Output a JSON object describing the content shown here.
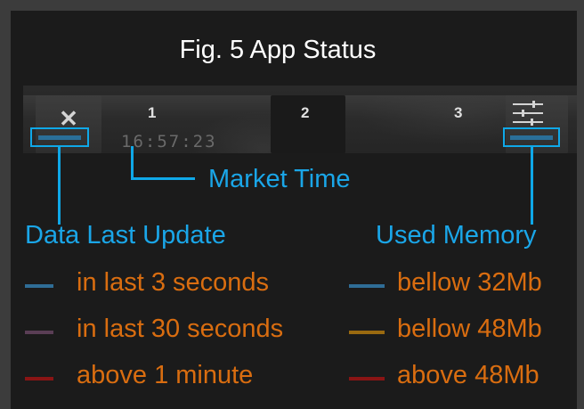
{
  "title": "Fig. 5 App Status",
  "toolbar": {
    "close_icon": "close-icon",
    "tab_1": "1",
    "tab_2": "2",
    "tab_3": "3",
    "clock": "16:57:23",
    "settings_icon": "sliders-icon"
  },
  "callouts": {
    "market_time": "Market Time",
    "data_last_update": "Data Last Update",
    "used_memory": "Used Memory"
  },
  "legend_left": [
    {
      "label": "in last 3 seconds",
      "color": "#2f6d96"
    },
    {
      "label": "in last 30 seconds",
      "color": "#5a3e55"
    },
    {
      "label": "above 1 minute",
      "color": "#8a1414"
    }
  ],
  "legend_right": [
    {
      "label": "bellow 32Mb",
      "color": "#2f6d96"
    },
    {
      "label": "bellow 48Mb",
      "color": "#9a6a10"
    },
    {
      "label": "above 48Mb",
      "color": "#8a1414"
    }
  ],
  "colors": {
    "accent_blue": "#1aa6e8",
    "legend_text": "#d96d10",
    "indicator": "#2a6f99"
  }
}
